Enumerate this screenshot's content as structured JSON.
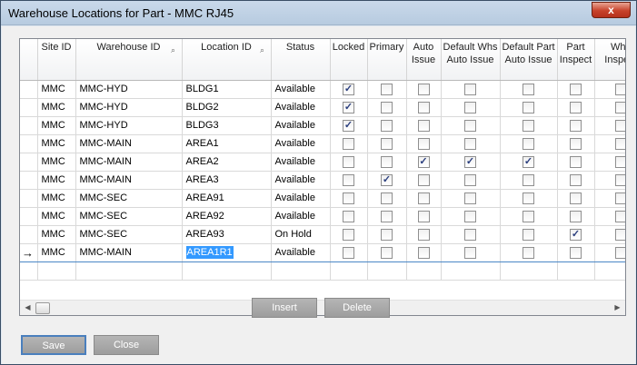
{
  "window": {
    "title": "Warehouse Locations for Part - MMC RJ45",
    "close_label": "x"
  },
  "grid": {
    "columns": [
      {
        "label": "",
        "key": "sel"
      },
      {
        "label": "Site ID",
        "key": "site"
      },
      {
        "label": "Warehouse ID",
        "key": "warehouse",
        "filter": true
      },
      {
        "label": "Location ID",
        "key": "location",
        "filter": true
      },
      {
        "label": "Status",
        "key": "status"
      },
      {
        "label": "Locked",
        "key": "locked"
      },
      {
        "label": "Primary",
        "key": "primary"
      },
      {
        "label": "Auto Issue",
        "key": "auto_issue"
      },
      {
        "label": "Default Whs Auto Issue",
        "key": "def_whs"
      },
      {
        "label": "Default Part Auto Issue",
        "key": "def_part"
      },
      {
        "label": "Part Inspect",
        "key": "part_inspect"
      },
      {
        "label": "Whs Inspect",
        "key": "whs_inspect"
      }
    ],
    "rows": [
      {
        "site": "MMC",
        "warehouse": "MMC-HYD",
        "location": "BLDG1",
        "status": "Available",
        "locked": true,
        "primary": false,
        "auto_issue": false,
        "def_whs": false,
        "def_part": false,
        "part_inspect": false,
        "whs_inspect": false
      },
      {
        "site": "MMC",
        "warehouse": "MMC-HYD",
        "location": "BLDG2",
        "status": "Available",
        "locked": true,
        "primary": false,
        "auto_issue": false,
        "def_whs": false,
        "def_part": false,
        "part_inspect": false,
        "whs_inspect": false
      },
      {
        "site": "MMC",
        "warehouse": "MMC-HYD",
        "location": "BLDG3",
        "status": "Available",
        "locked": true,
        "primary": false,
        "auto_issue": false,
        "def_whs": false,
        "def_part": false,
        "part_inspect": false,
        "whs_inspect": false
      },
      {
        "site": "MMC",
        "warehouse": "MMC-MAIN",
        "location": "AREA1",
        "status": "Available",
        "locked": false,
        "primary": false,
        "auto_issue": false,
        "def_whs": false,
        "def_part": false,
        "part_inspect": false,
        "whs_inspect": false
      },
      {
        "site": "MMC",
        "warehouse": "MMC-MAIN",
        "location": "AREA2",
        "status": "Available",
        "locked": false,
        "primary": false,
        "auto_issue": true,
        "def_whs": true,
        "def_part": true,
        "part_inspect": false,
        "whs_inspect": false
      },
      {
        "site": "MMC",
        "warehouse": "MMC-MAIN",
        "location": "AREA3",
        "status": "Available",
        "locked": false,
        "primary": true,
        "auto_issue": false,
        "def_whs": false,
        "def_part": false,
        "part_inspect": false,
        "whs_inspect": false
      },
      {
        "site": "MMC",
        "warehouse": "MMC-SEC",
        "location": "AREA91",
        "status": "Available",
        "locked": false,
        "primary": false,
        "auto_issue": false,
        "def_whs": false,
        "def_part": false,
        "part_inspect": false,
        "whs_inspect": false
      },
      {
        "site": "MMC",
        "warehouse": "MMC-SEC",
        "location": "AREA92",
        "status": "Available",
        "locked": false,
        "primary": false,
        "auto_issue": false,
        "def_whs": false,
        "def_part": false,
        "part_inspect": false,
        "whs_inspect": false
      },
      {
        "site": "MMC",
        "warehouse": "MMC-SEC",
        "location": "AREA93",
        "status": "On Hold",
        "locked": false,
        "primary": false,
        "auto_issue": false,
        "def_whs": false,
        "def_part": false,
        "part_inspect": true,
        "whs_inspect": false
      },
      {
        "site": "MMC",
        "warehouse": "MMC-MAIN",
        "location": "AREA1R1",
        "status": "Available",
        "locked": false,
        "primary": false,
        "auto_issue": false,
        "def_whs": false,
        "def_part": false,
        "part_inspect": false,
        "whs_inspect": false,
        "current": true
      }
    ]
  },
  "actions": {
    "insert_label": "Insert",
    "delete_label": "Delete"
  },
  "footer": {
    "save_label": "Save",
    "close_label": "Close"
  }
}
